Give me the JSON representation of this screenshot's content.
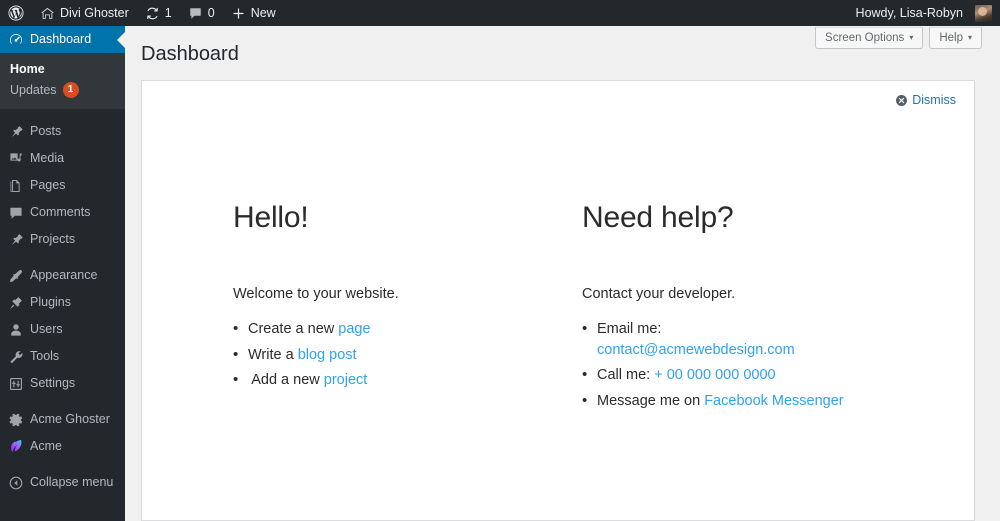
{
  "adminbar": {
    "logo_icon": "wordpress-logo-icon",
    "site_name": "Divi Ghoster",
    "home_icon": "home-icon",
    "updates_icon": "updates-icon",
    "updates_count": "1",
    "comments_icon": "comments-icon",
    "comments_count": "0",
    "new_icon": "plus-icon",
    "new_label": "New",
    "howdy": "Howdy, Lisa-Robyn",
    "avatar_icon": "user-avatar"
  },
  "sidebar": {
    "items": [
      {
        "label": "Dashboard",
        "icon": "dashboard-icon",
        "current": true,
        "key": "dashboard"
      },
      {
        "label": "Posts",
        "icon": "pin-icon",
        "current": false,
        "key": "posts"
      },
      {
        "label": "Media",
        "icon": "media-icon",
        "current": false,
        "key": "media"
      },
      {
        "label": "Pages",
        "icon": "pages-icon",
        "current": false,
        "key": "pages"
      },
      {
        "label": "Comments",
        "icon": "comment-icon",
        "current": false,
        "key": "comments"
      },
      {
        "label": "Projects",
        "icon": "pin-icon",
        "current": false,
        "key": "projects"
      },
      {
        "label": "Appearance",
        "icon": "brush-icon",
        "current": false,
        "key": "appearance"
      },
      {
        "label": "Plugins",
        "icon": "plug-icon",
        "current": false,
        "key": "plugins"
      },
      {
        "label": "Users",
        "icon": "user-icon",
        "current": false,
        "key": "users"
      },
      {
        "label": "Tools",
        "icon": "wrench-icon",
        "current": false,
        "key": "tools"
      },
      {
        "label": "Settings",
        "icon": "settings-icon",
        "current": false,
        "key": "settings"
      },
      {
        "label": "Acme Ghoster",
        "icon": "gear-icon",
        "current": false,
        "key": "acme-ghoster"
      },
      {
        "label": "Acme",
        "icon": "divi-logo-icon",
        "current": false,
        "key": "acme"
      }
    ],
    "submenu": {
      "home": "Home",
      "updates": "Updates",
      "updates_badge": "1"
    },
    "collapse": {
      "label": "Collapse menu",
      "icon": "collapse-arrow-icon"
    }
  },
  "header": {
    "title": "Dashboard",
    "screen_options": "Screen Options",
    "help": "Help",
    "caret": "▾"
  },
  "welcome": {
    "dismiss_label": "Dismiss",
    "dismiss_icon": "dismiss-circle-x-icon",
    "left": {
      "heading": "Hello!",
      "intro": "Welcome to your website.",
      "items": [
        {
          "text": "Create a new ",
          "link": "page"
        },
        {
          "text": "Write a ",
          "link": "blog post"
        },
        {
          "text": " Add a new ",
          "link": "project"
        }
      ]
    },
    "right": {
      "heading": "Need help?",
      "intro": "Contact your developer.",
      "email_label": "Email me:",
      "email_link": "contact@acmewebdesign.com",
      "call_label": "Call me: ",
      "call_link": "+ 00 000 000 0000",
      "message_label": "Message me on ",
      "message_link": "Facebook Messenger"
    }
  },
  "colors": {
    "adminbar_bg": "#23282d",
    "sidebar_bg": "#23282d",
    "submenu_bg": "#32373c",
    "current_blue": "#0073aa",
    "link_blue": "#2ea3f2",
    "admin_link_blue": "#2271b1",
    "badge_red": "#d54e21",
    "page_bg": "#f0f0f1",
    "panel_bg": "#ffffff",
    "text_dark": "#2b2b2b"
  }
}
